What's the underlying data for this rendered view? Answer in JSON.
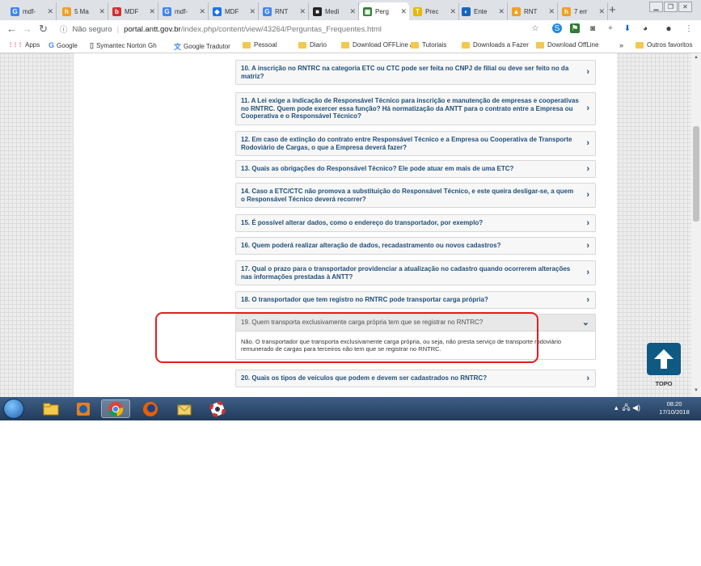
{
  "browser": {
    "tabs": [
      {
        "title": "mdf-",
        "icon": "google-icon",
        "color": "#4285f4",
        "glyph": "G"
      },
      {
        "title": "5 Ma",
        "icon": "h-icon",
        "color": "#f0a020",
        "glyph": "h"
      },
      {
        "title": "MDF",
        "icon": "b-icon",
        "color": "#d32f2f",
        "glyph": "b"
      },
      {
        "title": "mdf-",
        "icon": "google-icon",
        "color": "#4285f4",
        "glyph": "G"
      },
      {
        "title": "MDF",
        "icon": "mdf-icon",
        "color": "#1a73e8",
        "glyph": "◆"
      },
      {
        "title": "RNT",
        "icon": "google-icon",
        "color": "#4285f4",
        "glyph": "G"
      },
      {
        "title": "Medi",
        "icon": "medium-icon",
        "color": "#222222",
        "glyph": "■"
      },
      {
        "title": "Perg",
        "icon": "antt-icon",
        "color": "#2e7d32",
        "glyph": "▣"
      },
      {
        "title": "Prec",
        "icon": "t-icon",
        "color": "#e6b800",
        "glyph": "T"
      },
      {
        "title": "Ente",
        "icon": "eye-icon",
        "color": "#1565c0",
        "glyph": "◐"
      },
      {
        "title": "RNT",
        "icon": "truck-icon",
        "color": "#f0a020",
        "glyph": "▲"
      },
      {
        "title": "7 err",
        "icon": "h-icon",
        "color": "#f0a020",
        "glyph": "h"
      }
    ],
    "new_tab": "+",
    "url_security": "Não seguro",
    "url_domain": "portal.antt.gov.br",
    "url_path": "/index.php/content/view/43264/Perguntas_Frequentes.html",
    "bookmarks": [
      {
        "label": "Apps",
        "type": "apps"
      },
      {
        "label": "Google",
        "type": "google"
      },
      {
        "label": "Symantec Norton Gh",
        "type": "page"
      },
      {
        "label": "Google Tradutor",
        "type": "translate"
      },
      {
        "label": "Pessoal",
        "type": "folder"
      },
      {
        "label": "Diario",
        "type": "folder"
      },
      {
        "label": "Download OFFLine A",
        "type": "folder"
      },
      {
        "label": "Tutoriais",
        "type": "folder"
      },
      {
        "label": "Downloads a Fazer",
        "type": "folder"
      },
      {
        "label": "Download OffLine",
        "type": "folder"
      }
    ],
    "bookmarks_overflow": "»",
    "other_bookmarks": "Outros favoritos"
  },
  "faq": [
    {
      "q": "10. A inscrição no RNTRC na categoria ETC ou CTC pode ser feita no CNPJ de filial ou deve ser feito no da matriz?"
    },
    {
      "q": "11. A Lei exige a indicação de Responsável Técnico para inscrição e manutenção de empresas e cooperativas no RNTRC. Quem pode exercer essa função? Há normatização da ANTT para o contrato entre a Empresa ou Cooperativa e o Responsável Técnico?"
    },
    {
      "q": "12. Em caso de extinção do contrato entre Responsável Técnico e a Empresa ou Cooperativa de Transporte Rodoviário de Cargas, o que a Empresa deverá fazer?"
    },
    {
      "q": "13. Quais as obrigações do Responsável Técnico? Ele pode atuar em mais de uma ETC?"
    },
    {
      "q": "14. Caso a ETC/CTC não promova a substituição do Responsável Técnico, e este queira desligar-se, a quem o Responsável Técnico deverá recorrer?"
    },
    {
      "q": "15. É possível alterar dados, como o endereço do transportador, por exemplo?"
    },
    {
      "q": "16. Quem poderá realizar alteração de dados, recadastramento ou novos cadastros?"
    },
    {
      "q": "17. Qual o prazo para o transportador providenciar a atualização no cadastro quando ocorrerem alterações nas informações prestadas à ANTT?"
    },
    {
      "q": "18. O transportador que tem registro no RNTRC pode transportar carga própria?"
    },
    {
      "q": "19. Quem transporta exclusivamente carga própria tem que se registrar no RNTRC?",
      "a": "Não. O transportador que transporta exclusivamente carga própria, ou seja, não presta serviço de transporte rodoviário remunerado de cargas para terceiros não tem que se registrar no RNTRC.",
      "expanded": true
    },
    {
      "q": "20. Quais os tipos de veículos que podem e devem ser cadastrados no RNTRC?"
    }
  ],
  "chevron_closed": "›",
  "chevron_open": "⌄",
  "topo_label": "TOPO",
  "taskbar": {
    "apps": [
      "explorer-icon",
      "media-player-icon",
      "chrome-icon",
      "firefox-icon",
      "mail-icon",
      "lifebuoy-icon"
    ],
    "active": "chrome-icon",
    "time": "08:20",
    "date": "17/10/2018"
  }
}
